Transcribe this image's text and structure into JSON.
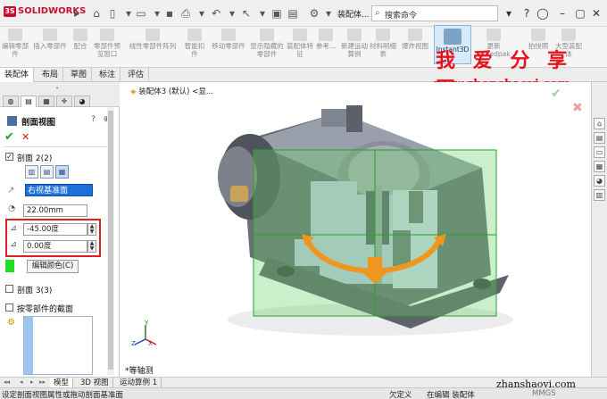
{
  "app": {
    "logo_text": "SOLIDWORKS",
    "doc_title": "装配体...",
    "search": {
      "placeholder": "搜索命令"
    }
  },
  "ribbon": {
    "items": [
      "编辑零部件",
      "插入零部件",
      "配合",
      "零部件预览窗口",
      "线性零部件阵列",
      "智能扣件",
      "移动零部件",
      "显示隐藏的零部件",
      "装配体特征",
      "参考...",
      "新建运动算例",
      "材料明细表",
      "爆炸视图",
      "Instant3D",
      "更新 Speedpak",
      "拍快照",
      "大型装配体"
    ]
  },
  "command_tabs": [
    "装配体",
    "布局",
    "草图",
    "标注",
    "评估"
  ],
  "watermark": {
    "title": "我 爱 分 享 网",
    "url": "www.zhanshaoyi.com",
    "bottom": "zhanshaoyi.com"
  },
  "property_manager": {
    "title": "剖面视图",
    "ok_symbol": "✔",
    "cancel_symbol": "✕",
    "section2": {
      "label": "剖面 2(2)",
      "checked": true
    },
    "plane_value": "右视基准面",
    "offset_value": "22.00mm",
    "angle1_value": "-45.00度",
    "angle2_value": "0.00度",
    "edit_color_label": "编辑颜色(C)",
    "section_color": "#22dd22",
    "section3": {
      "label": "剖面 3(3)",
      "checked": false
    },
    "by_component": {
      "label": "按零部件的截面",
      "checked": false
    }
  },
  "viewport": {
    "breadcrumb": "装配体3 (默认) <显...",
    "view_label": "*等轴测",
    "triad": {
      "x": "X",
      "y": "Y",
      "z": "Z"
    },
    "section_plane_color": "#66d066",
    "arrow_color": "#f0961e"
  },
  "bottom_tabs": [
    "模型",
    "3D 视图",
    "运动算例 1"
  ],
  "status": {
    "hint": "设定剖面视图属性或拖动剖面基准面",
    "state": "欠定义",
    "editing": "在编辑 装配体",
    "units": "MMGS"
  }
}
